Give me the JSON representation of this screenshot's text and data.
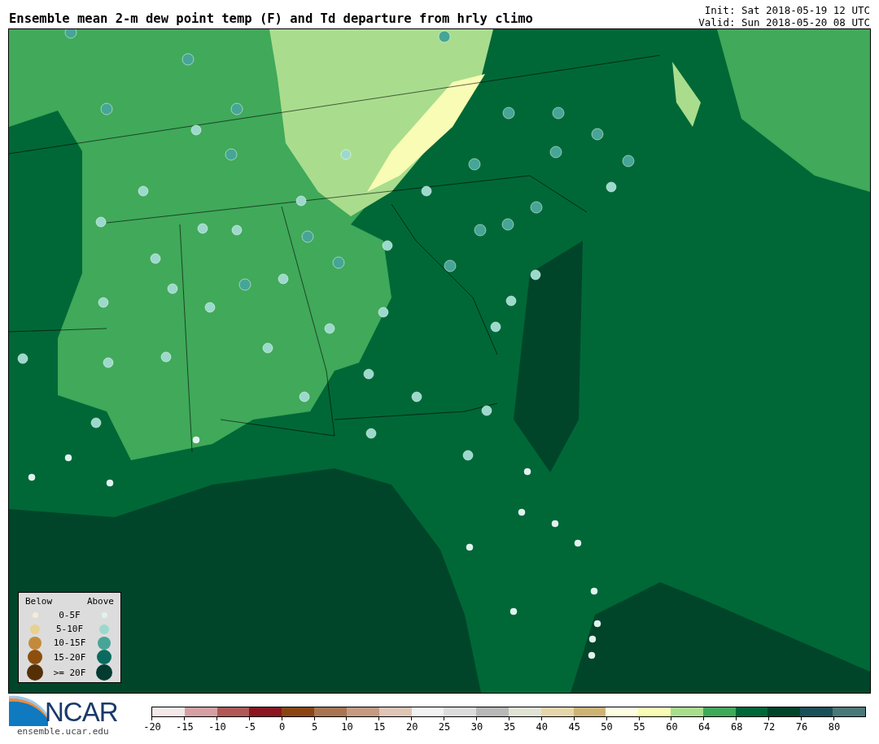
{
  "title": "Ensemble mean 2-m dew point temp (F) and Td departure from hrly climo",
  "init": "Init: Sat 2018-05-19 12 UTC",
  "valid": "Valid: Sun 2018-05-20 08 UTC",
  "legend": {
    "below_heading": "Below",
    "above_heading": "Above",
    "rows": [
      {
        "label": "0-5F",
        "below": {
          "color": "#f5ecd6"
        },
        "above": {
          "color": "#e0f2ef"
        }
      },
      {
        "label": "5-10F",
        "below": {
          "color": "#e8d08f"
        },
        "above": {
          "color": "#9bd9cc"
        }
      },
      {
        "label": "10-15F",
        "below": {
          "color": "#c48a3c"
        },
        "above": {
          "color": "#46a596"
        }
      },
      {
        "label": "15-20F",
        "below": {
          "color": "#8c4f0e"
        },
        "above": {
          "color": "#0b6a60"
        }
      },
      {
        "label": ">= 20F",
        "below": {
          "color": "#553006"
        },
        "above": {
          "color": "#023b30"
        }
      }
    ]
  },
  "logo": {
    "wordmark": "NCAR",
    "url": "ensemble.ucar.edu"
  },
  "colorbar": {
    "segments": [
      {
        "color": "#f5e8e8"
      },
      {
        "color": "#d4a0a4"
      },
      {
        "color": "#b05858"
      },
      {
        "color": "#8b1520"
      },
      {
        "color": "#8b4513"
      },
      {
        "color": "#a87552"
      },
      {
        "color": "#c49a82"
      },
      {
        "color": "#dfc5b5"
      },
      {
        "color": "#f2f2f2"
      },
      {
        "color": "#dcdcdc"
      },
      {
        "color": "#b8b8b8"
      },
      {
        "color": "#e0e2d4"
      },
      {
        "color": "#e5d6ab"
      },
      {
        "color": "#cdb476"
      },
      {
        "color": "#fdfde0"
      },
      {
        "color": "#f8fcb4"
      },
      {
        "color": "#a9dd8d"
      },
      {
        "color": "#40a95a"
      },
      {
        "color": "#006837"
      },
      {
        "color": "#004529"
      },
      {
        "color": "#1a5058"
      },
      {
        "color": "#4a7878"
      }
    ],
    "ticks": [
      "-20",
      "-15",
      "-10",
      "-5",
      "0",
      "5",
      "10",
      "15",
      "20",
      "25",
      "30",
      "35",
      "40",
      "45",
      "50",
      "55",
      "60",
      "64",
      "68",
      "72",
      "76",
      "80"
    ]
  }
}
